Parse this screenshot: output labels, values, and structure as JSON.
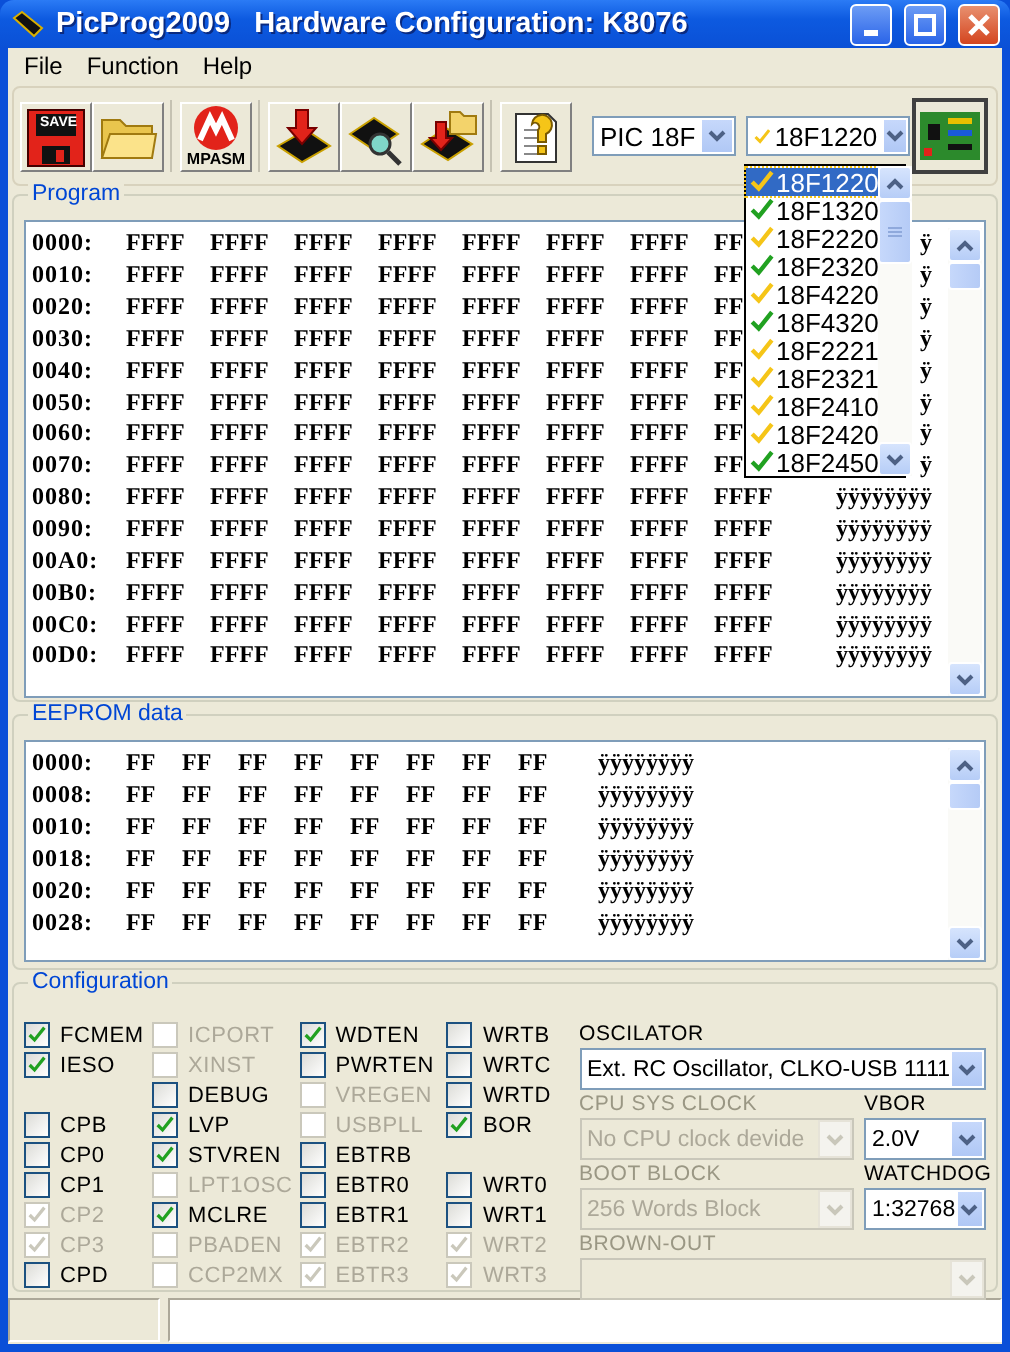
{
  "window": {
    "title": "PicProg2009   Hardware Configuration: K8076"
  },
  "menu": [
    "File",
    "Function",
    "Help"
  ],
  "toolbar": {
    "buttons": [
      {
        "kind": "save",
        "label": "SAVE",
        "separator_before": false
      },
      {
        "kind": "open",
        "separator_before": false
      },
      {
        "kind": "mpasm",
        "label": "MPASM",
        "separator_before": true
      },
      {
        "kind": "write",
        "separator_before": true
      },
      {
        "kind": "verify",
        "separator_before": false
      },
      {
        "kind": "read",
        "separator_before": false
      },
      {
        "kind": "help",
        "separator_before": true
      }
    ],
    "family": "PIC 18F",
    "device": {
      "value": "18F1220",
      "color": "#f5c518"
    }
  },
  "device_list": [
    {
      "label": "18F1220",
      "color": "#f5c518",
      "selected": true
    },
    {
      "label": "18F1320",
      "color": "#21a121",
      "selected": false
    },
    {
      "label": "18F2220",
      "color": "#f5c518",
      "selected": false
    },
    {
      "label": "18F2320",
      "color": "#21a121",
      "selected": false
    },
    {
      "label": "18F4220",
      "color": "#f5c518",
      "selected": false
    },
    {
      "label": "18F4320",
      "color": "#21a121",
      "selected": false
    },
    {
      "label": "18F2221",
      "color": "#f5c518",
      "selected": false
    },
    {
      "label": "18F2321",
      "color": "#f5c518",
      "selected": false
    },
    {
      "label": "18F2410",
      "color": "#f5c518",
      "selected": false
    },
    {
      "label": "18F2420",
      "color": "#f5c518",
      "selected": false
    },
    {
      "label": "18F2450",
      "color": "#21a121",
      "selected": false
    }
  ],
  "program": {
    "title": "Program",
    "rows": [
      {
        "address": "0000:",
        "cells": [
          "FFFF",
          "FFFF",
          "FFFF",
          "FFFF",
          "FFFF",
          "FFFF",
          "FFFF",
          "FF"
        ],
        "ascii": "ÿ"
      },
      {
        "address": "0010:",
        "cells": [
          "FFFF",
          "FFFF",
          "FFFF",
          "FFFF",
          "FFFF",
          "FFFF",
          "FFFF",
          "FF"
        ],
        "ascii": "ÿ"
      },
      {
        "address": "0020:",
        "cells": [
          "FFFF",
          "FFFF",
          "FFFF",
          "FFFF",
          "FFFF",
          "FFFF",
          "FFFF",
          "FF"
        ],
        "ascii": "ÿ"
      },
      {
        "address": "0030:",
        "cells": [
          "FFFF",
          "FFFF",
          "FFFF",
          "FFFF",
          "FFFF",
          "FFFF",
          "FFFF",
          "FF"
        ],
        "ascii": "ÿ"
      },
      {
        "address": "0040:",
        "cells": [
          "FFFF",
          "FFFF",
          "FFFF",
          "FFFF",
          "FFFF",
          "FFFF",
          "FFFF",
          "FF"
        ],
        "ascii": "ÿ"
      },
      {
        "address": "0050:",
        "cells": [
          "FFFF",
          "FFFF",
          "FFFF",
          "FFFF",
          "FFFF",
          "FFFF",
          "FFFF",
          "FF"
        ],
        "ascii": "ÿ"
      },
      {
        "address": "0060:",
        "cells": [
          "FFFF",
          "FFFF",
          "FFFF",
          "FFFF",
          "FFFF",
          "FFFF",
          "FFFF",
          "FF"
        ],
        "ascii": "ÿ"
      },
      {
        "address": "0070:",
        "cells": [
          "FFFF",
          "FFFF",
          "FFFF",
          "FFFF",
          "FFFF",
          "FFFF",
          "FFFF",
          "FF"
        ],
        "ascii": "ÿ"
      },
      {
        "address": "0080:",
        "cells": [
          "FFFF",
          "FFFF",
          "FFFF",
          "FFFF",
          "FFFF",
          "FFFF",
          "FFFF",
          "FFFF"
        ],
        "ascii": "ÿÿÿÿÿÿÿÿ"
      },
      {
        "address": "0090:",
        "cells": [
          "FFFF",
          "FFFF",
          "FFFF",
          "FFFF",
          "FFFF",
          "FFFF",
          "FFFF",
          "FFFF"
        ],
        "ascii": "ÿÿÿÿÿÿÿÿ"
      },
      {
        "address": "00A0:",
        "cells": [
          "FFFF",
          "FFFF",
          "FFFF",
          "FFFF",
          "FFFF",
          "FFFF",
          "FFFF",
          "FFFF"
        ],
        "ascii": "ÿÿÿÿÿÿÿÿ"
      },
      {
        "address": "00B0:",
        "cells": [
          "FFFF",
          "FFFF",
          "FFFF",
          "FFFF",
          "FFFF",
          "FFFF",
          "FFFF",
          "FFFF"
        ],
        "ascii": "ÿÿÿÿÿÿÿÿ"
      },
      {
        "address": "00C0:",
        "cells": [
          "FFFF",
          "FFFF",
          "FFFF",
          "FFFF",
          "FFFF",
          "FFFF",
          "FFFF",
          "FFFF"
        ],
        "ascii": "ÿÿÿÿÿÿÿÿ"
      },
      {
        "address": "00D0:",
        "cells": [
          "FFFF",
          "FFFF",
          "FFFF",
          "FFFF",
          "FFFF",
          "FFFF",
          "FFFF",
          "FFFF"
        ],
        "ascii": "ÿÿÿÿÿÿÿÿ"
      }
    ]
  },
  "eeprom": {
    "title": "EEPROM data",
    "rows": [
      {
        "address": "0000:",
        "cells": [
          "FF",
          "FF",
          "FF",
          "FF",
          "FF",
          "FF",
          "FF",
          "FF"
        ],
        "ascii": "ÿÿÿÿÿÿÿÿ"
      },
      {
        "address": "0008:",
        "cells": [
          "FF",
          "FF",
          "FF",
          "FF",
          "FF",
          "FF",
          "FF",
          "FF"
        ],
        "ascii": "ÿÿÿÿÿÿÿÿ"
      },
      {
        "address": "0010:",
        "cells": [
          "FF",
          "FF",
          "FF",
          "FF",
          "FF",
          "FF",
          "FF",
          "FF"
        ],
        "ascii": "ÿÿÿÿÿÿÿÿ"
      },
      {
        "address": "0018:",
        "cells": [
          "FF",
          "FF",
          "FF",
          "FF",
          "FF",
          "FF",
          "FF",
          "FF"
        ],
        "ascii": "ÿÿÿÿÿÿÿÿ"
      },
      {
        "address": "0020:",
        "cells": [
          "FF",
          "FF",
          "FF",
          "FF",
          "FF",
          "FF",
          "FF",
          "FF"
        ],
        "ascii": "ÿÿÿÿÿÿÿÿ"
      },
      {
        "address": "0028:",
        "cells": [
          "FF",
          "FF",
          "FF",
          "FF",
          "FF",
          "FF",
          "FF",
          "FF"
        ],
        "ascii": "ÿÿÿÿÿÿÿÿ"
      }
    ]
  },
  "configuration": {
    "title": "Configuration",
    "columns": [
      [
        {
          "kind": "checkbox",
          "label": "FCMEM",
          "checked": true,
          "disabled": false
        },
        {
          "kind": "checkbox",
          "label": "IESO",
          "checked": true,
          "disabled": false
        },
        {
          "kind": "blank"
        },
        {
          "kind": "checkbox",
          "label": "CPB",
          "checked": false,
          "disabled": false
        },
        {
          "kind": "checkbox",
          "label": "CP0",
          "checked": false,
          "disabled": false
        },
        {
          "kind": "checkbox",
          "label": "CP1",
          "checked": false,
          "disabled": false
        },
        {
          "kind": "checkbox",
          "label": "CP2",
          "checked": true,
          "disabled": true
        },
        {
          "kind": "checkbox",
          "label": "CP3",
          "checked": true,
          "disabled": true
        },
        {
          "kind": "checkbox",
          "label": "CPD",
          "checked": false,
          "disabled": false
        }
      ],
      [
        {
          "kind": "checkbox",
          "label": "ICPORT",
          "checked": false,
          "disabled": true
        },
        {
          "kind": "checkbox",
          "label": "XINST",
          "checked": false,
          "disabled": true
        },
        {
          "kind": "checkbox",
          "label": "DEBUG",
          "checked": false,
          "disabled": false
        },
        {
          "kind": "checkbox",
          "label": "LVP",
          "checked": true,
          "disabled": false
        },
        {
          "kind": "checkbox",
          "label": "STVREN",
          "checked": true,
          "disabled": false
        },
        {
          "kind": "checkbox",
          "label": "LPT1OSC",
          "checked": false,
          "disabled": true
        },
        {
          "kind": "checkbox",
          "label": "MCLRE",
          "checked": true,
          "disabled": false
        },
        {
          "kind": "checkbox",
          "label": "PBADEN",
          "checked": false,
          "disabled": true
        },
        {
          "kind": "checkbox",
          "label": "CCP2MX",
          "checked": false,
          "disabled": true
        }
      ],
      [
        {
          "kind": "checkbox",
          "label": "WDTEN",
          "checked": true,
          "disabled": false
        },
        {
          "kind": "checkbox",
          "label": "PWRTEN",
          "checked": false,
          "disabled": false
        },
        {
          "kind": "checkbox",
          "label": "VREGEN",
          "checked": false,
          "disabled": true
        },
        {
          "kind": "checkbox",
          "label": "USBPLL",
          "checked": false,
          "disabled": true
        },
        {
          "kind": "checkbox",
          "label": "EBTRB",
          "checked": false,
          "disabled": false
        },
        {
          "kind": "checkbox",
          "label": "EBTR0",
          "checked": false,
          "disabled": false
        },
        {
          "kind": "checkbox",
          "label": "EBTR1",
          "checked": false,
          "disabled": false
        },
        {
          "kind": "checkbox",
          "label": "EBTR2",
          "checked": true,
          "disabled": true
        },
        {
          "kind": "checkbox",
          "label": "EBTR3",
          "checked": true,
          "disabled": true
        }
      ],
      [
        {
          "kind": "checkbox",
          "label": "WRTB",
          "checked": false,
          "disabled": false
        },
        {
          "kind": "checkbox",
          "label": "WRTC",
          "checked": false,
          "disabled": false
        },
        {
          "kind": "checkbox",
          "label": "WRTD",
          "checked": false,
          "disabled": false
        },
        {
          "kind": "checkbox",
          "label": "BOR",
          "checked": true,
          "disabled": false
        },
        {
          "kind": "blank"
        },
        {
          "kind": "checkbox",
          "label": "WRT0",
          "checked": false,
          "disabled": false
        },
        {
          "kind": "checkbox",
          "label": "WRT1",
          "checked": false,
          "disabled": false
        },
        {
          "kind": "checkbox",
          "label": "WRT2",
          "checked": true,
          "disabled": true
        },
        {
          "kind": "checkbox",
          "label": "WRT3",
          "checked": true,
          "disabled": true
        }
      ]
    ],
    "settings": [
      [
        {
          "label": "OSCILATOR",
          "value": "Ext. RC Oscillator, CLKO-USB 1111",
          "disabled": false
        }
      ],
      [
        {
          "label": "CPU SYS CLOCK",
          "value": "No CPU clock devide",
          "disabled": true
        },
        {
          "label": "VBOR",
          "value": "2.0V",
          "disabled": false
        }
      ],
      [
        {
          "label": "BOOT BLOCK",
          "value": "256 Words Block",
          "disabled": true
        },
        {
          "label": "WATCHDOG",
          "value": "1:32768",
          "disabled": false
        }
      ],
      [
        {
          "label": "BROWN-OUT",
          "disabled": true
        }
      ]
    ]
  }
}
